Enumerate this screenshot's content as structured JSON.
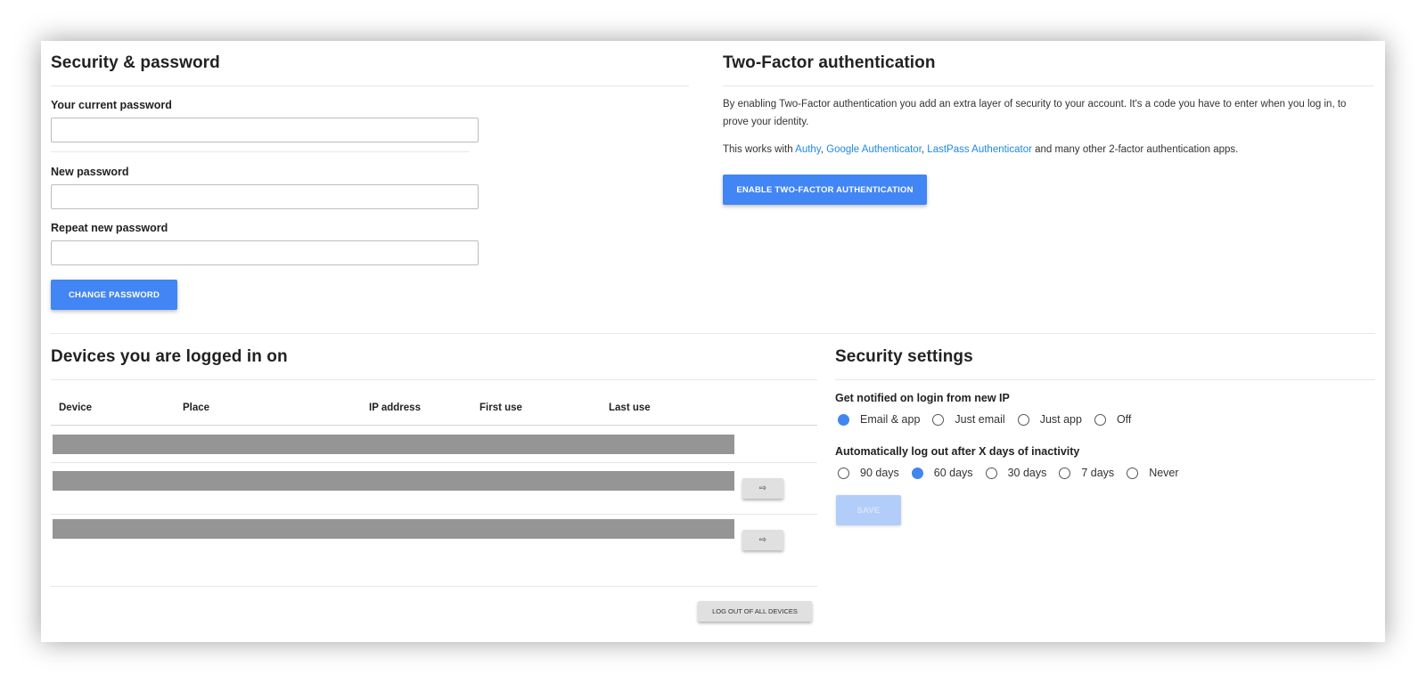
{
  "security_password": {
    "title": "Security & password",
    "current_password_label": "Your current password",
    "new_password_label": "New password",
    "repeat_password_label": "Repeat new password",
    "current_password_value": "",
    "new_password_value": "",
    "repeat_password_value": "",
    "change_button": "CHANGE PASSWORD"
  },
  "two_factor": {
    "title": "Two-Factor authentication",
    "description": "By enabling Two-Factor authentication you add an extra layer of security to your account. It's a code you have to enter when you log in, to prove your identity.",
    "works_prefix": "This works with ",
    "links": [
      "Authy",
      "Google Authenticator",
      "LastPass Authenticator"
    ],
    "sep_comma": ", ",
    "works_suffix": " and many other 2-factor authentication apps.",
    "enable_button": "ENABLE TWO-FACTOR AUTHENTICATION"
  },
  "devices": {
    "title": "Devices you are logged in on",
    "columns": [
      "Device",
      "Place",
      "IP address",
      "First use",
      "Last use"
    ],
    "logout_icon": "logout-icon",
    "logout_all_button": "LOG OUT OF ALL DEVICES"
  },
  "security_settings": {
    "title": "Security settings",
    "notify_label": "Get notified on login from new IP",
    "notify_options": [
      "Email & app",
      "Just email",
      "Just app",
      "Off"
    ],
    "notify_selected": "Email & app",
    "autologout_label": "Automatically log out after X days of inactivity",
    "autologout_options": [
      "90 days",
      "60 days",
      "30 days",
      "7 days",
      "Never"
    ],
    "autologout_selected": "60 days",
    "save_button": "SAVE"
  },
  "colors": {
    "accent": "#4285f4",
    "link": "#1e88e5",
    "placeholder_bar": "#959595"
  }
}
